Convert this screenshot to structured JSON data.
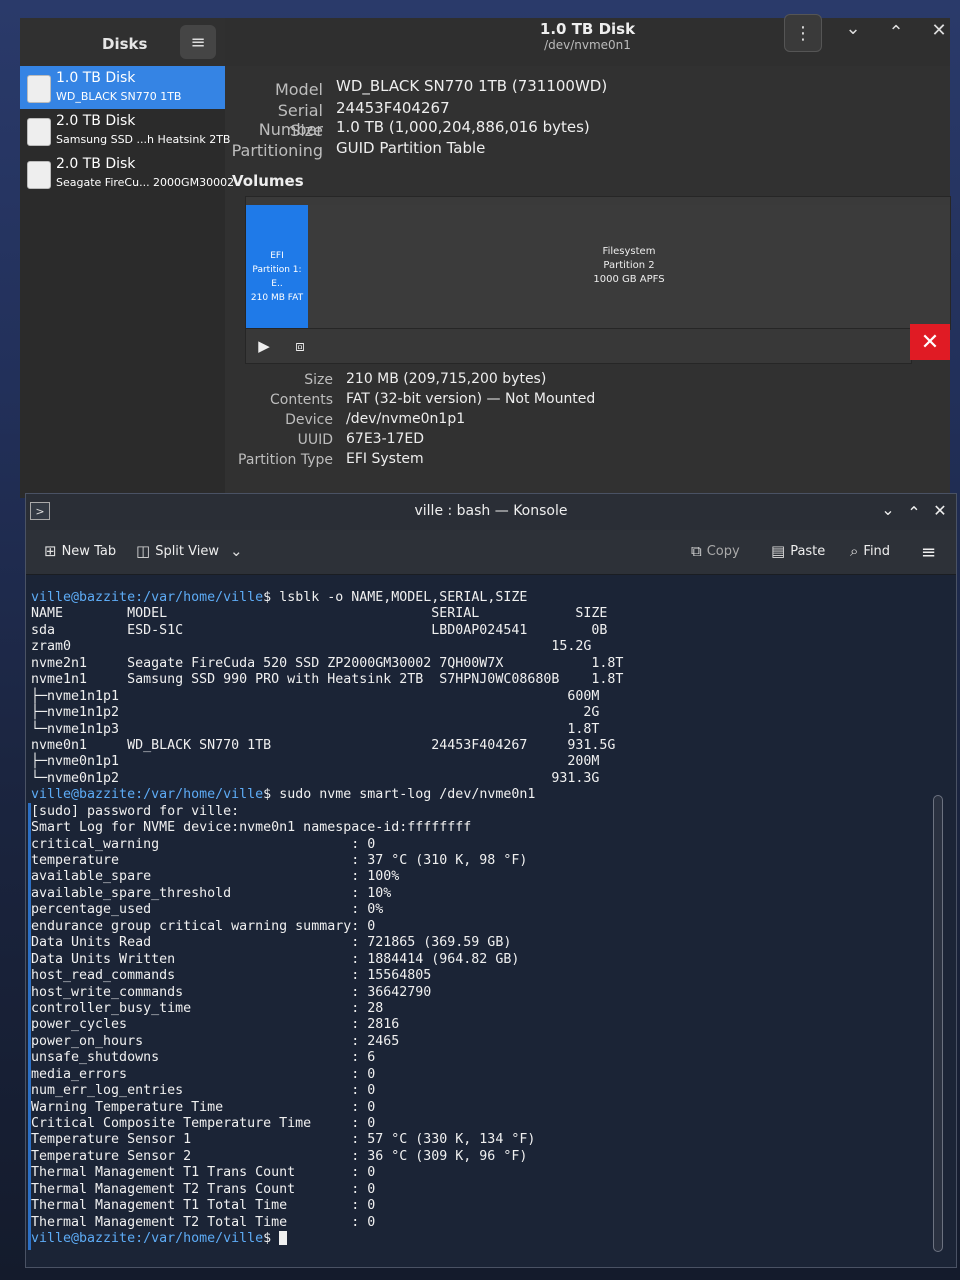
{
  "disks": {
    "sidebar_title": "Disks",
    "items": [
      {
        "name": "1.0 TB Disk",
        "model": "WD_BLACK SN770 1TB"
      },
      {
        "name": "2.0 TB Disk",
        "model": "Samsung SSD ...h Heatsink 2TB"
      },
      {
        "name": "2.0 TB Disk",
        "model": "Seagate FireCu... 2000GM30002"
      }
    ],
    "header_title": "1.0 TB Disk",
    "header_subtitle": "/dev/nvme0n1",
    "disk_props": [
      {
        "key": "Model",
        "value": "WD_BLACK SN770 1TB (731100WD)"
      },
      {
        "key": "Serial Number",
        "value": "24453F404267"
      },
      {
        "key": "Size",
        "value": "1.0 TB (1,000,204,886,016 bytes)"
      },
      {
        "key": "Partitioning",
        "value": "GUID Partition Table"
      }
    ],
    "volumes_label": "Volumes",
    "efi_block": [
      "EFI",
      "Partition 1: E..",
      "210 MB FAT"
    ],
    "fs_block": [
      "Filesystem",
      "Partition 2",
      "1000 GB APFS"
    ],
    "partition_props": [
      {
        "key": "Size",
        "value": "210 MB (209,715,200 bytes)"
      },
      {
        "key": "Contents",
        "value": "FAT (32-bit version) — Not Mounted"
      },
      {
        "key": "Device",
        "value": "/dev/nvme0n1p1"
      },
      {
        "key": "UUID",
        "value": "67E3-17ED"
      },
      {
        "key": "Partition Type",
        "value": "EFI System"
      }
    ]
  },
  "konsole": {
    "title": "ville : bash — Konsole",
    "toolbar": {
      "new_tab": "New Tab",
      "split_view": "Split View",
      "copy": "Copy",
      "paste": "Paste",
      "find": "Find"
    },
    "prompt": "ville@bazzite:/var/home/ville$",
    "lines": [
      {
        "prompt": "ville@bazzite:/var/home/ville$",
        "text": " lsblk -o NAME,MODEL,SERIAL,SIZE"
      },
      {
        "prompt": "",
        "text": "NAME        MODEL                                 SERIAL            SIZE"
      },
      {
        "prompt": "",
        "text": "sda         ESD-S1C                               LBD0AP024541        0B"
      },
      {
        "prompt": "",
        "text": "zram0                                                            15.2G"
      },
      {
        "prompt": "",
        "text": "nvme2n1     Seagate FireCuda 520 SSD ZP2000GM30002 7QH00W7X           1.8T"
      },
      {
        "prompt": "",
        "text": "nvme1n1     Samsung SSD 990 PRO with Heatsink 2TB  S7HPNJ0WC08680B    1.8T"
      },
      {
        "prompt": "",
        "text": "├─nvme1n1p1                                                        600M"
      },
      {
        "prompt": "",
        "text": "├─nvme1n1p2                                                          2G"
      },
      {
        "prompt": "",
        "text": "└─nvme1n1p3                                                        1.8T"
      },
      {
        "prompt": "",
        "text": "nvme0n1     WD_BLACK SN770 1TB                    24453F404267     931.5G"
      },
      {
        "prompt": "",
        "text": "├─nvme0n1p1                                                        200M"
      },
      {
        "prompt": "",
        "text": "└─nvme0n1p2                                                      931.3G"
      },
      {
        "prompt": "ville@bazzite:/var/home/ville$",
        "text": " sudo nvme smart-log /dev/nvme0n1"
      },
      {
        "prompt": "",
        "text": "[sudo] password for ville:"
      },
      {
        "prompt": "",
        "text": "Smart Log for NVME device:nvme0n1 namespace-id:ffffffff"
      },
      {
        "prompt": "",
        "text": "critical_warning                        : 0"
      },
      {
        "prompt": "",
        "text": "temperature                             : 37 °C (310 K, 98 °F)"
      },
      {
        "prompt": "",
        "text": "available_spare                         : 100%"
      },
      {
        "prompt": "",
        "text": "available_spare_threshold               : 10%"
      },
      {
        "prompt": "",
        "text": "percentage_used                         : 0%"
      },
      {
        "prompt": "",
        "text": "endurance group critical warning summary: 0"
      },
      {
        "prompt": "",
        "text": "Data Units Read                         : 721865 (369.59 GB)"
      },
      {
        "prompt": "",
        "text": "Data Units Written                      : 1884414 (964.82 GB)"
      },
      {
        "prompt": "",
        "text": "host_read_commands                      : 15564805"
      },
      {
        "prompt": "",
        "text": "host_write_commands                     : 36642790"
      },
      {
        "prompt": "",
        "text": "controller_busy_time                    : 28"
      },
      {
        "prompt": "",
        "text": "power_cycles                            : 2816"
      },
      {
        "prompt": "",
        "text": "power_on_hours                          : 2465"
      },
      {
        "prompt": "",
        "text": "unsafe_shutdowns                        : 6"
      },
      {
        "prompt": "",
        "text": "media_errors                            : 0"
      },
      {
        "prompt": "",
        "text": "num_err_log_entries                     : 0"
      },
      {
        "prompt": "",
        "text": "Warning Temperature Time                : 0"
      },
      {
        "prompt": "",
        "text": "Critical Composite Temperature Time     : 0"
      },
      {
        "prompt": "",
        "text": "Temperature Sensor 1                    : 57 °C (330 K, 134 °F)"
      },
      {
        "prompt": "",
        "text": "Temperature Sensor 2                    : 36 °C (309 K, 96 °F)"
      },
      {
        "prompt": "",
        "text": "Thermal Management T1 Trans Count       : 0"
      },
      {
        "prompt": "",
        "text": "Thermal Management T2 Trans Count       : 0"
      },
      {
        "prompt": "",
        "text": "Thermal Management T1 Total Time        : 0"
      },
      {
        "prompt": "",
        "text": "Thermal Management T2 Total Time        : 0"
      }
    ]
  }
}
